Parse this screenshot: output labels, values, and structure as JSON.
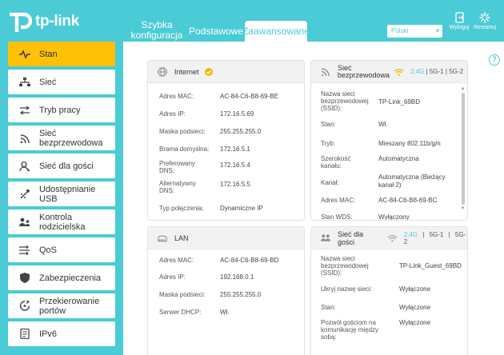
{
  "brand": {
    "name": "tp-link"
  },
  "tabs": [
    "Szybka konfiguracja",
    "Podstawowe",
    "Zaawansowane"
  ],
  "language": "Polski",
  "header_buttons": {
    "logout": "Wyloguj",
    "reboot": "Restartuj"
  },
  "sidebar": [
    {
      "label": "Stan",
      "icon": "pulse-icon"
    },
    {
      "label": "Sieć",
      "icon": "network-icon"
    },
    {
      "label": "Tryb pracy",
      "icon": "swap-icon"
    },
    {
      "label": "Sieć bezprzewodowa",
      "icon": "wifi-icon"
    },
    {
      "label": "Sieć dla gości",
      "icon": "guest-icon"
    },
    {
      "label": "Udostępnianie USB",
      "icon": "usb-icon"
    },
    {
      "label": "Kontrola rodzicielska",
      "icon": "parental-icon"
    },
    {
      "label": "QoS",
      "icon": "qos-icon"
    },
    {
      "label": "Zabezpieczenia",
      "icon": "shield-icon"
    },
    {
      "label": "Przekierowanie portów",
      "icon": "forward-icon"
    },
    {
      "label": "IPv6",
      "icon": "ipv6-icon"
    }
  ],
  "internet": {
    "title": "Internet",
    "rows": [
      {
        "label": "Adres MAC:",
        "value": "AC-84-C6-B8-69-BE"
      },
      {
        "label": "Adres IP:",
        "value": "172.16.5.69"
      },
      {
        "label": "Maska podsieci:",
        "value": "255.255.255.0"
      },
      {
        "label": "Brama domyślna:",
        "value": "172.16.5.1"
      },
      {
        "label": "Preferowany DNS:",
        "value": "172.16.5.4"
      },
      {
        "label": "Alternatywny DNS:",
        "value": "172.16.5.5"
      },
      {
        "label": "Typ połączenia:",
        "value": "Dynamiczne IP"
      }
    ]
  },
  "wireless": {
    "title": "Sieć bezprzewodowa",
    "bands": {
      "b24": "2,4G",
      "b51": "5G-1",
      "b52": "5G-2",
      "sep": "|"
    },
    "rows": [
      {
        "label": "Nazwa sieci bezprzewodowej (SSID):",
        "value": "TP-Link_69BD"
      },
      {
        "label": "Stan:",
        "value": "Wł."
      },
      {
        "label": "Tryb:",
        "value": "Mieszany 802.11b/g/n"
      },
      {
        "label": "Szerokość kanału:",
        "value": "Automatyczna"
      },
      {
        "label": "Kanał:",
        "value": "Automatyczna (Bieżący kanał 2)"
      },
      {
        "label": "Adres MAC:",
        "value": "AC-84-C6-B8-69-BC"
      },
      {
        "label": "Stan WDS:",
        "value": "Wyłączony"
      }
    ]
  },
  "lan": {
    "title": "LAN",
    "rows": [
      {
        "label": "Adres MAC:",
        "value": "AC-84-C6-B8-69-BD"
      },
      {
        "label": "Adres IP:",
        "value": "192.168.0.1"
      },
      {
        "label": "Maska podsieci:",
        "value": "255.255.255.0"
      },
      {
        "label": "Serwer DHCP:",
        "value": "Wł."
      }
    ]
  },
  "guest": {
    "title": "Sieć dla gości",
    "bands": {
      "b24": "2,4G",
      "b51": "5G-1",
      "b52": "5G-2",
      "sep": "|"
    },
    "rows": [
      {
        "label": "Nazwa sieci bezprzewodowej (SSID):",
        "value": "TP-Link_Guest_69BD"
      },
      {
        "label": "Ukryj nazwę sieci:",
        "value": "Wyłączone"
      },
      {
        "label": "Stan:",
        "value": "Wyłączone"
      },
      {
        "label": "Pozwól gościom na komunikację między sobą:",
        "value": "Wyłączone"
      }
    ]
  },
  "colors": {
    "accent": "#4acbd6",
    "active": "#ffc107",
    "ok": "#f5b800"
  }
}
